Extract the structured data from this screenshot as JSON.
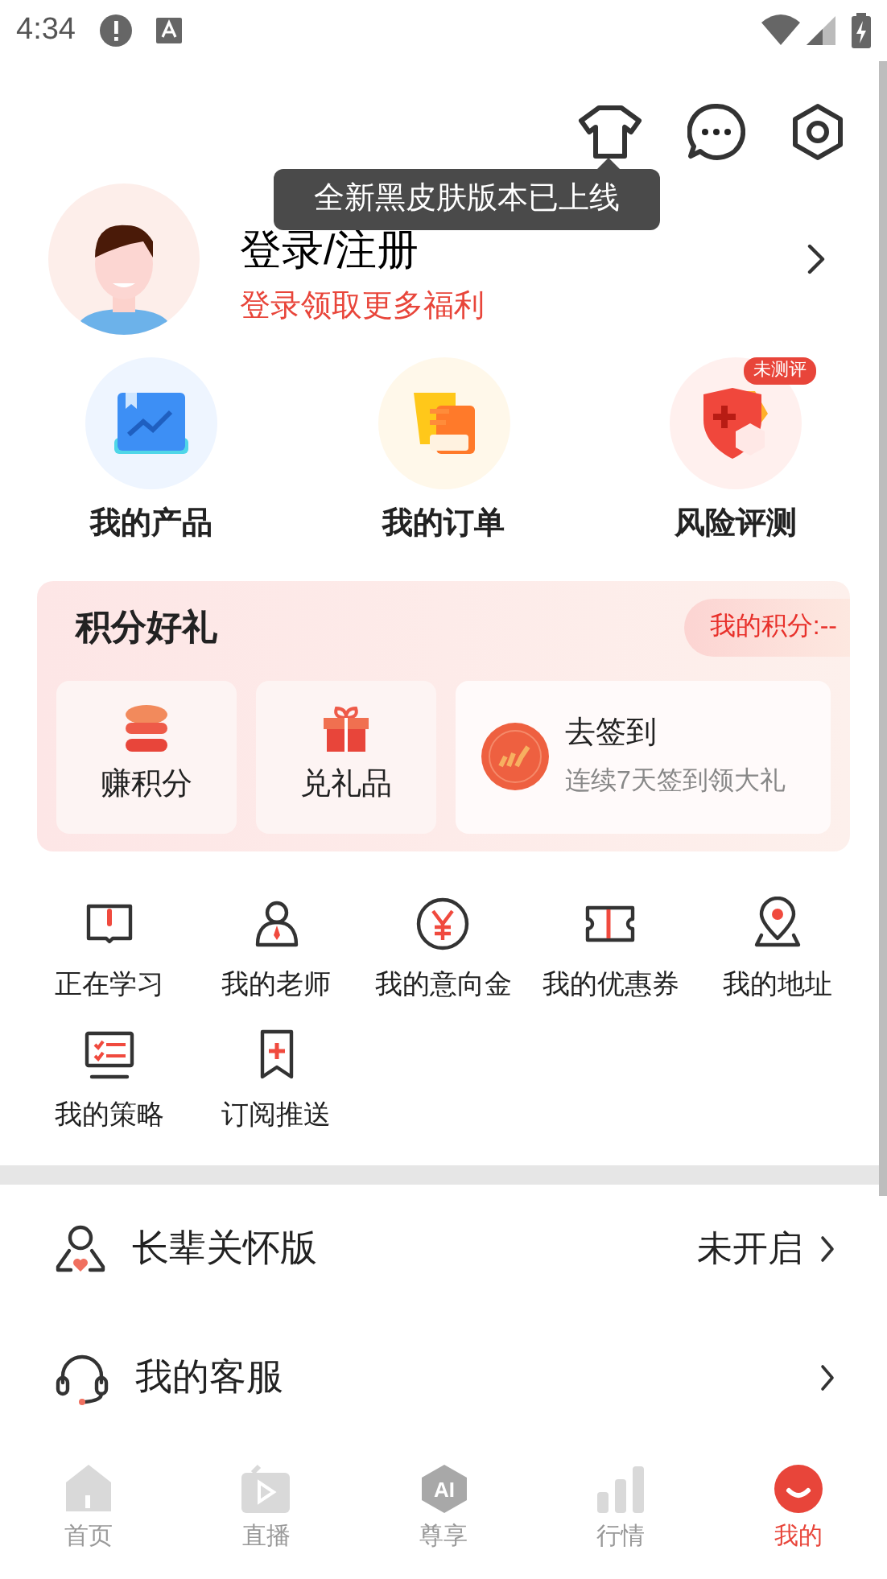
{
  "status_bar": {
    "time": "4:34"
  },
  "tooltip": {
    "text": "全新黑皮肤版本已上线"
  },
  "profile": {
    "title": "登录/注册",
    "subtitle": "登录领取更多福利"
  },
  "quick_entries": [
    {
      "kind": "product",
      "label": "我的产品"
    },
    {
      "kind": "order",
      "label": "我的订单"
    },
    {
      "kind": "risk",
      "label": "风险评测",
      "badge": "未测评"
    }
  ],
  "points_card": {
    "title": "积分好礼",
    "my_points": "我的积分:--",
    "earn": "赚积分",
    "redeem": "兑礼品",
    "checkin_title": "去签到",
    "checkin_subtitle": "连续7天签到领大礼"
  },
  "services": [
    {
      "kind": "study",
      "label": "正在学习"
    },
    {
      "kind": "teacher",
      "label": "我的老师"
    },
    {
      "kind": "deposit",
      "label": "我的意向金"
    },
    {
      "kind": "coupon",
      "label": "我的优惠券"
    },
    {
      "kind": "address",
      "label": "我的地址"
    },
    {
      "kind": "strategy",
      "label": "我的策略"
    },
    {
      "kind": "subscribe",
      "label": "订阅推送"
    }
  ],
  "settings": [
    {
      "kind": "elder",
      "label": "长辈关怀版",
      "value": "未开启"
    },
    {
      "kind": "service",
      "label": "我的客服"
    }
  ],
  "tabs": [
    {
      "kind": "home",
      "label": "首页",
      "selected": false
    },
    {
      "kind": "live",
      "label": "直播",
      "selected": false
    },
    {
      "kind": "ai",
      "label": "尊享",
      "icon_text": "AI",
      "selected": false
    },
    {
      "kind": "market",
      "label": "行情",
      "selected": false
    },
    {
      "kind": "mine",
      "label": "我的",
      "selected": true
    }
  ]
}
